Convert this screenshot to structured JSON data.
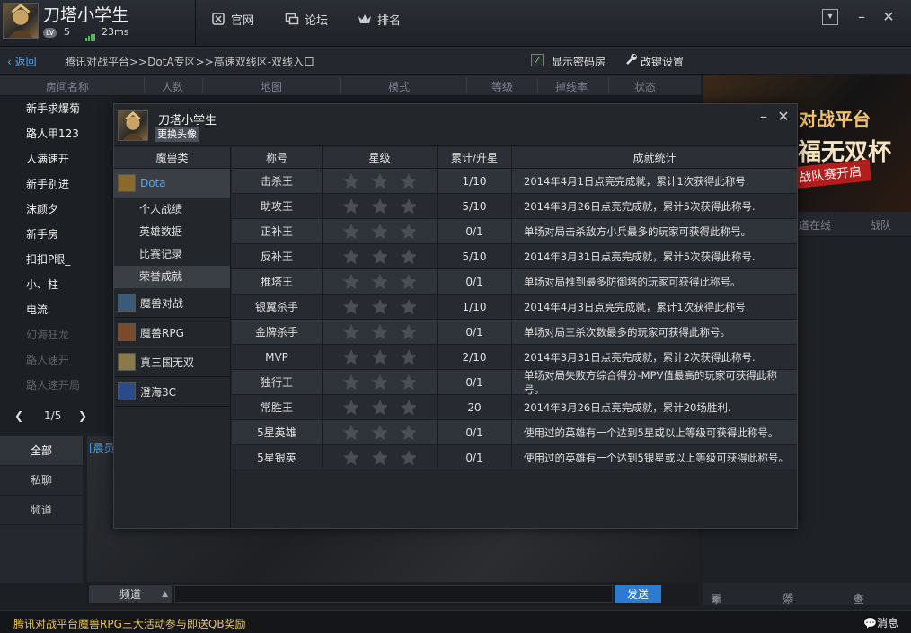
{
  "user": {
    "name": "刀塔小学生",
    "level_badge": "LV",
    "level": "5",
    "ping": "23ms"
  },
  "topnav": [
    {
      "label": "官网",
      "icon": "official-site-icon"
    },
    {
      "label": "论坛",
      "icon": "forum-icon"
    },
    {
      "label": "排名",
      "icon": "crown-icon"
    }
  ],
  "breadcrumb": {
    "back_label": "返回",
    "path": "腾讯对战平台>>DotA专区>>高速双线区-双线入口",
    "show_password_rooms_label": "显示密码房",
    "show_password_rooms_checked": true,
    "change_key_settings_label": "改键设置"
  },
  "room_table": {
    "headers": [
      "房间名称",
      "人数",
      "地图",
      "模式",
      "等级",
      "掉线率",
      "状态"
    ],
    "rooms": [
      {
        "name": "新手求爆菊",
        "dim": false
      },
      {
        "name": "路人甲123",
        "dim": false
      },
      {
        "name": "人满速开",
        "dim": false
      },
      {
        "name": "新手别进",
        "dim": false
      },
      {
        "name": "沫颜夕",
        "dim": false
      },
      {
        "name": "新手房",
        "dim": false
      },
      {
        "name": "扣扣P眼_",
        "dim": false
      },
      {
        "name": "小、柱",
        "dim": false
      },
      {
        "name": "电流",
        "dim": false
      },
      {
        "name": "幻海狂龙",
        "dim": true
      },
      {
        "name": "路人速开",
        "dim": true
      },
      {
        "name": "路人速开局",
        "dim": true
      }
    ],
    "pager": {
      "prev": "❮",
      "page": "1/5",
      "next": "❯"
    }
  },
  "chat": {
    "tabs": [
      "全部",
      "私聊",
      "频道"
    ],
    "message_fragment": "[晨员",
    "channel_label": "频道",
    "send_label": "发送"
  },
  "right_panel": {
    "banner_line1": "对战平台",
    "banner_line2": "福无双杯",
    "banner_line3": "战队赛开启",
    "tabs": [
      "道在线",
      "战队"
    ],
    "footer": [
      "添加分组",
      "添加好友",
      "查找玩家"
    ]
  },
  "status_bar": {
    "text": "腾讯对战平台魔兽RPG三大活动参与即送QB奖励",
    "message_label": "消息"
  },
  "dialog": {
    "name": "刀塔小学生",
    "change_avatar_label": "更换头像",
    "category_title": "魔兽类",
    "games": [
      {
        "label": "Dota",
        "active": true,
        "icon_color": "#8a6a2a"
      },
      {
        "label": "魔兽对战",
        "active": false,
        "icon_color": "#3a5a7a"
      },
      {
        "label": "魔兽RPG",
        "active": false,
        "icon_color": "#7a4a2a"
      },
      {
        "label": "真三国无双",
        "active": false,
        "icon_color": "#8a7a4a"
      },
      {
        "label": "澄海3C",
        "active": false,
        "icon_color": "#2a4a8a"
      }
    ],
    "dota_submenu": [
      {
        "label": "个人战绩",
        "active": false
      },
      {
        "label": "英雄数据",
        "active": false
      },
      {
        "label": "比赛记录",
        "active": false
      },
      {
        "label": "荣誉成就",
        "active": true
      }
    ],
    "table_headers": [
      "称号",
      "星级",
      "累计/升星",
      "成就统计"
    ],
    "rows": [
      {
        "title": "击杀王",
        "progress": "1/10",
        "desc": "2014年4月1日点亮完成就，累计1次获得此称号."
      },
      {
        "title": "助攻王",
        "progress": "5/10",
        "desc": "2014年3月26日点亮完成就，累计5次获得此称号."
      },
      {
        "title": "正补王",
        "progress": "0/1",
        "desc": "单场对局击杀敌方小兵最多的玩家可获得此称号。"
      },
      {
        "title": "反补王",
        "progress": "5/10",
        "desc": "2014年3月31日点亮完成就，累计5次获得此称号."
      },
      {
        "title": "推塔王",
        "progress": "0/1",
        "desc": "单场对局推到最多防御塔的玩家可获得此称号。"
      },
      {
        "title": "银翼杀手",
        "progress": "1/10",
        "desc": "2014年4月3日点亮完成就，累计1次获得此称号."
      },
      {
        "title": "金牌杀手",
        "progress": "0/1",
        "desc": "单场对局三杀次数最多的玩家可获得此称号。"
      },
      {
        "title": "MVP",
        "progress": "2/10",
        "desc": "2014年3月31日点亮完成就，累计2次获得此称号."
      },
      {
        "title": "独行王",
        "progress": "0/1",
        "desc": "单场对局失败方综合得分-MPV值最高的玩家可获得此称号。"
      },
      {
        "title": "常胜王",
        "progress": "20",
        "desc": "2014年3月26日点亮完成就，累计20场胜利."
      },
      {
        "title": "5星英雄",
        "progress": "0/1",
        "desc": "使用过的英雄有一个达到5星或以上等级可获得此称号。"
      },
      {
        "title": "5星银英",
        "progress": "0/1",
        "desc": "使用过的英雄有一个达到5银星或以上等级可获得此称号。"
      }
    ],
    "stars_per_row": 3
  }
}
